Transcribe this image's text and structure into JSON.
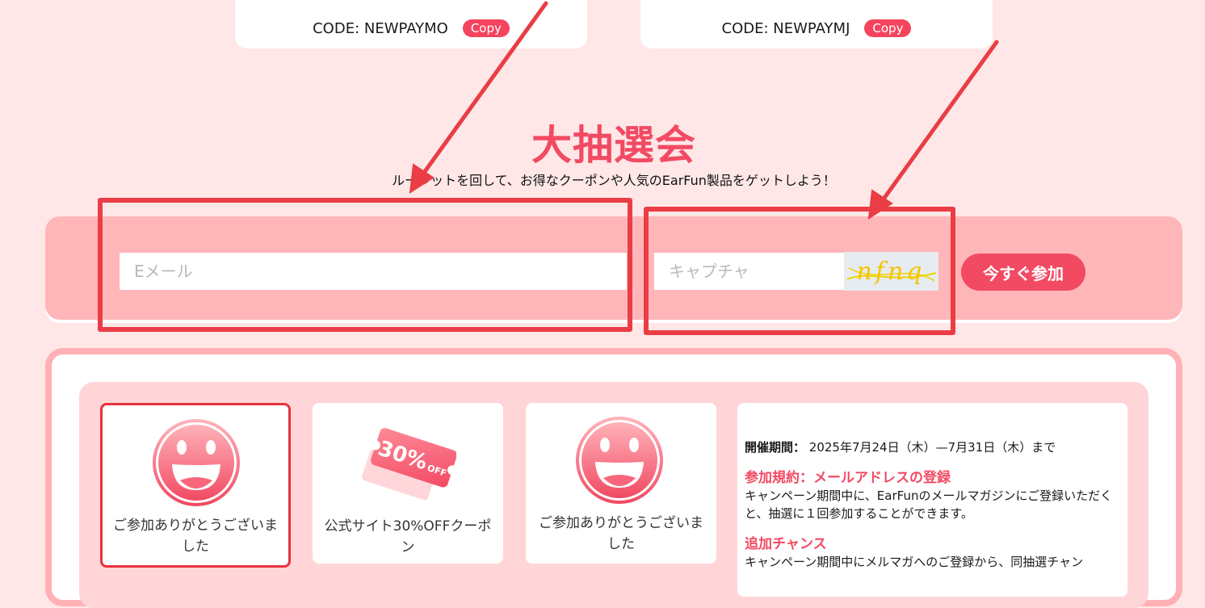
{
  "coupons": [
    {
      "code": "CODE: NEWPAYMO",
      "copy_label": "Copy"
    },
    {
      "code": "CODE: NEWPAYMJ",
      "copy_label": "Copy"
    }
  ],
  "lottery": {
    "title": "大抽選会",
    "subtitle": "ルーレットを回して、お得なクーポンや人気のEarFun製品をゲットしよう！"
  },
  "form": {
    "email_placeholder": "Eメール",
    "captcha_placeholder": "キャプチャ",
    "captcha_text": "nfnq",
    "join_label": "今すぐ参加"
  },
  "prizes": [
    {
      "label": "ご参加ありがとうございました",
      "icon": "smiley-face-icon"
    },
    {
      "label": "公式サイト30%OFFクーポン",
      "icon": "discount-coupon-icon",
      "coupon_text": "30%",
      "coupon_sub": "OFF"
    },
    {
      "label": "ご参加ありがとうございました",
      "icon": "smiley-face-icon"
    }
  ],
  "info": {
    "period_label": "開催期間：",
    "period_value": " 2025年7月24日（木）—7月31日（木）まで",
    "rule_title": "参加規約：メールアドレスの登録",
    "rule_text": "キャンペーン期間中に、EarFunのメールマガジンにご登録いただくと、抽選に１回参加することができます。",
    "extra_title": "追加チャンス",
    "extra_text": "キャンペーン期間中にメルマガへのご登録から、同抽選チャン"
  },
  "colors": {
    "accent": "#f24a63",
    "background": "#ffe7e7",
    "annotation": "#ea3d45"
  }
}
